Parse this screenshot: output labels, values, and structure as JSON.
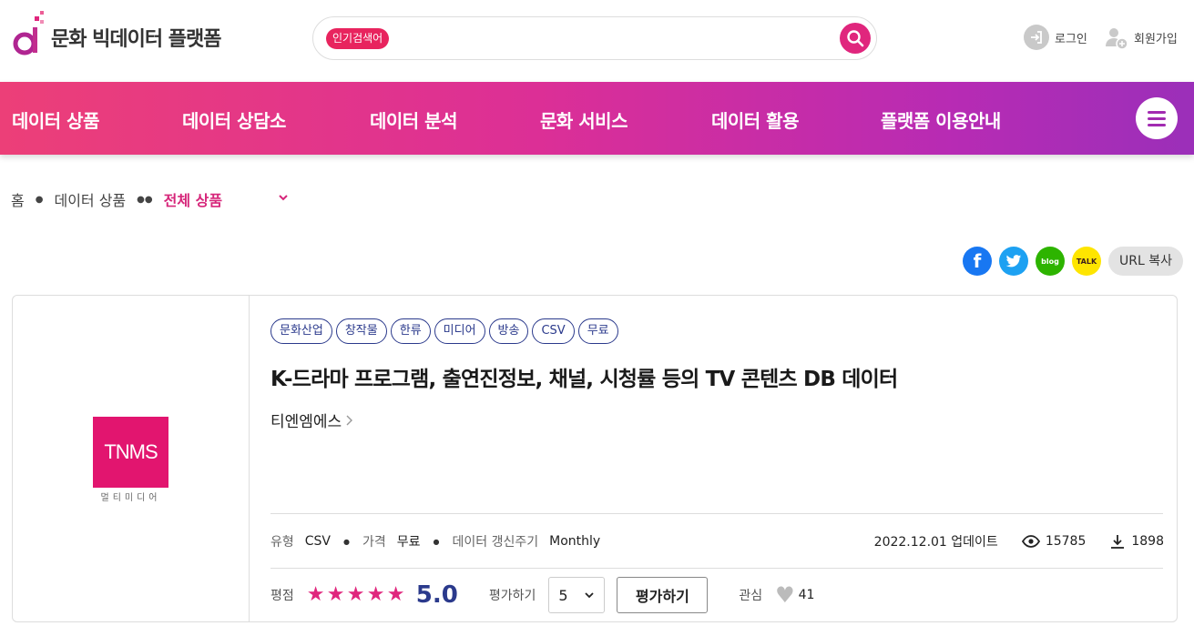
{
  "header": {
    "logo_text": "문화 빅데이터 플랫폼",
    "search_badge": "인기검색어",
    "search_placeholder": "",
    "login_label": "로그인",
    "signup_label": "회원가입"
  },
  "nav": {
    "items": [
      "데이터 상품",
      "데이터 상담소",
      "데이터 분석",
      "문화 서비스",
      "데이터 활용",
      "플랫폼 이용안내"
    ]
  },
  "breadcrumb": {
    "home": "홈",
    "level1": "데이터 상품",
    "current": "전체 상품"
  },
  "share": {
    "facebook": "f",
    "blog": "blog",
    "talk": "TALK",
    "url_copy": "URL 복사"
  },
  "product": {
    "logo_text": "TNMS",
    "logo_sub": "멀티미디어",
    "tags": [
      "문화산업",
      "창작물",
      "한류",
      "미디어",
      "방송",
      "CSV",
      "무료"
    ],
    "title": "K-드라마 프로그램, 출연진정보, 채널, 시청률 등의 TV 콘텐츠 DB 데이터",
    "provider": "티엔엠에스",
    "meta": {
      "type_label": "유형",
      "type_value": "CSV",
      "price_label": "가격",
      "price_value": "무료",
      "cycle_label": "데이터 갱신주기",
      "cycle_value": "Monthly",
      "updated": "2022.12.01 업데이트",
      "views": "15785",
      "downloads": "1898"
    },
    "rating": {
      "label": "평점",
      "score": "5.0",
      "stars": 5,
      "rate_label": "평가하기",
      "select_value": "5",
      "rate_button": "평가하기",
      "fav_label": "관심",
      "fav_count": "41"
    }
  },
  "colors": {
    "accent": "#e0267d",
    "navy": "#2b3a8c",
    "nav_start": "#ec3f78",
    "nav_end": "#9b2fb9"
  }
}
